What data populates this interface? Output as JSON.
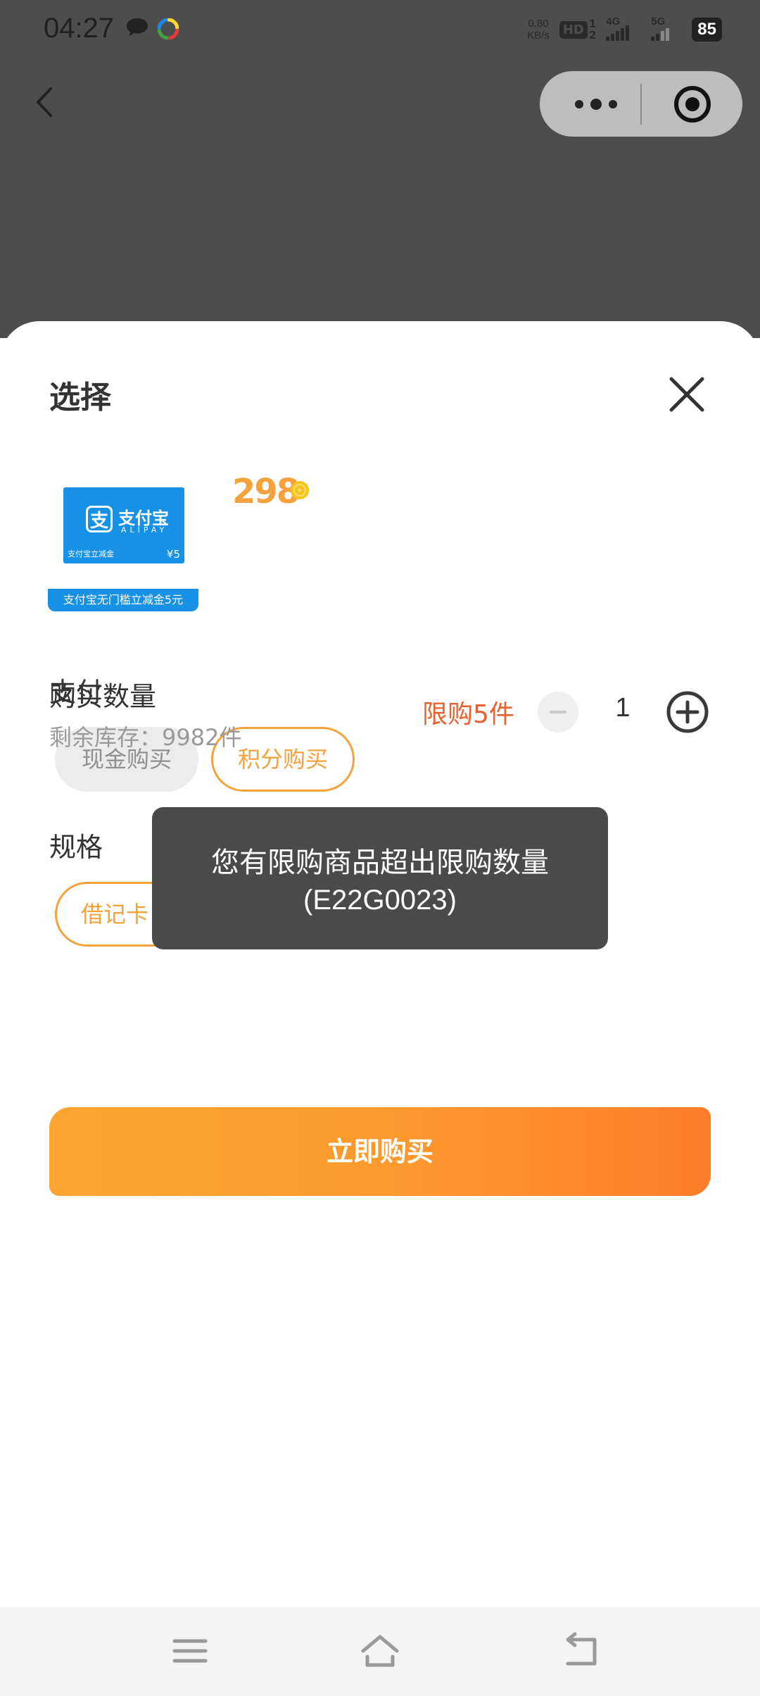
{
  "status_bar": {
    "time": "04:27",
    "net_speed_value": "0.80",
    "net_speed_unit": "KB/s",
    "hd_label": "HD",
    "sim1_index": "1",
    "sim2_index": "2",
    "network_4g": "4G",
    "network_5g": "5G",
    "battery_level": "85"
  },
  "sheet": {
    "title": "选择",
    "product": {
      "card_brand": "支付宝",
      "card_brand_sub": "ALIPAY",
      "card_small_text": "支付宝立减金",
      "card_value": "¥5",
      "caption": "支付宝无门槛立减金5元",
      "price": "298",
      "price_icon": "gold-coin-icon"
    },
    "payment": {
      "label": "支付",
      "options": [
        "现金购买",
        "积分购买"
      ],
      "selected": "积分购买"
    },
    "spec": {
      "label": "规格",
      "options": [
        "借记卡"
      ],
      "selected": "借记卡"
    },
    "quantity": {
      "label": "购买数量",
      "stock": "剩余库存：9982件",
      "limit": "限购5件",
      "value": "1"
    },
    "buy_button": "立即购买"
  },
  "toast": {
    "line1": "您有限购商品超出限购数量",
    "line2": "(E22G0023)"
  },
  "colors": {
    "accent": "#f5a13c",
    "limit_text": "#e8612f",
    "overlay": "#4d4d4d",
    "toast_bg": "#4a4a4a",
    "alipay_blue": "#1791e6"
  }
}
